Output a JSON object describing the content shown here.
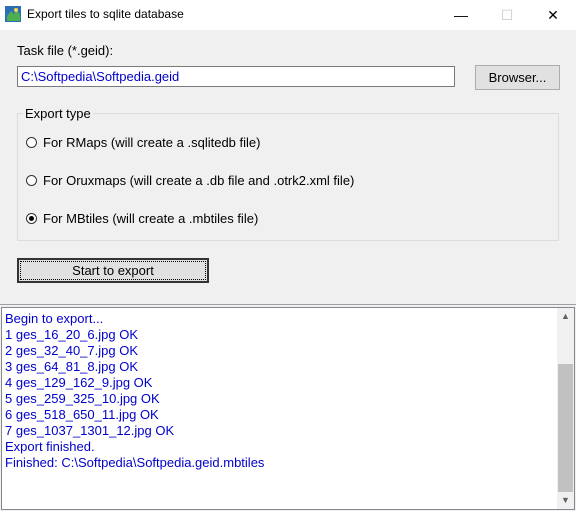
{
  "window": {
    "title": "Export tiles to sqlite database",
    "minimize": "—",
    "maximize": "☐",
    "close": "✕"
  },
  "task": {
    "label": "Task file (*.geid):",
    "value": "C:\\Softpedia\\Softpedia.geid",
    "browse_label": "Browser..."
  },
  "export_type": {
    "label": "Export type",
    "options": [
      {
        "label": "For RMaps (will create a .sqlitedb file)",
        "checked": false
      },
      {
        "label": "For Oruxmaps (will create a .db file and .otrk2.xml file)",
        "checked": false
      },
      {
        "label": "For MBtiles (will create a .mbtiles file)",
        "checked": true
      }
    ]
  },
  "start_label": "Start to export",
  "log": {
    "lines": [
      "Begin to export...",
      "1 ges_16_20_6.jpg OK",
      "2 ges_32_40_7.jpg OK",
      "3 ges_64_81_8.jpg OK",
      "4 ges_129_162_9.jpg OK",
      "5 ges_259_325_10.jpg OK",
      "6 ges_518_650_11.jpg OK",
      "7 ges_1037_1301_12.jpg OK",
      "Export finished.",
      "Finished: C:\\Softpedia\\Softpedia.geid.mbtiles"
    ]
  },
  "colors": {
    "log_text": "#0000cc",
    "field_text": "#0000cc"
  }
}
